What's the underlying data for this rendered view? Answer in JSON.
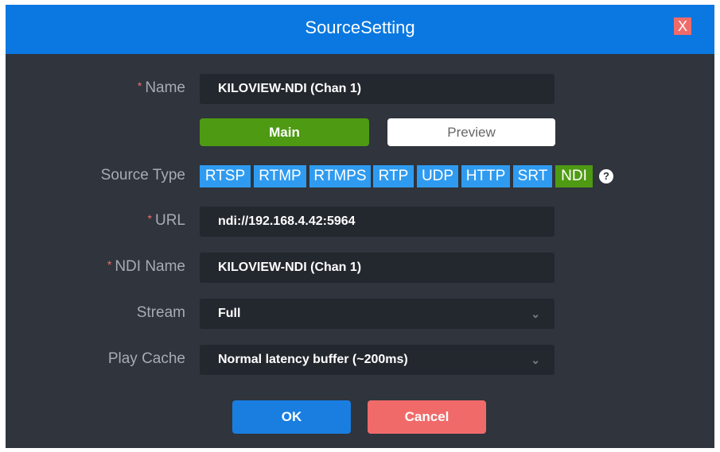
{
  "title": "SourceSetting",
  "close_label": "X",
  "required_mark": "*",
  "fields": {
    "name": {
      "label": "Name",
      "value": "KILOVIEW-NDI (Chan 1)"
    },
    "source_type": {
      "label": "Source Type",
      "options": [
        "RTSP",
        "RTMP",
        "RTMPS",
        "RTP",
        "UDP",
        "HTTP",
        "SRT",
        "NDI"
      ],
      "selected": "NDI",
      "help": "?"
    },
    "url": {
      "label": "URL",
      "value": "ndi://192.168.4.42:5964"
    },
    "ndi_name": {
      "label": "NDI Name",
      "value": "KILOVIEW-NDI (Chan 1)"
    },
    "stream": {
      "label": "Stream",
      "value": "Full"
    },
    "play_cache": {
      "label": "Play Cache",
      "value": "Normal latency buffer (~200ms)"
    }
  },
  "stream_tabs": {
    "main": "Main",
    "preview": "Preview"
  },
  "buttons": {
    "ok": "OK",
    "cancel": "Cancel"
  },
  "colors": {
    "header": "#0a78e0",
    "active": "#4e9a13",
    "tag": "#2f9bf0",
    "cancel": "#f06a6a"
  }
}
